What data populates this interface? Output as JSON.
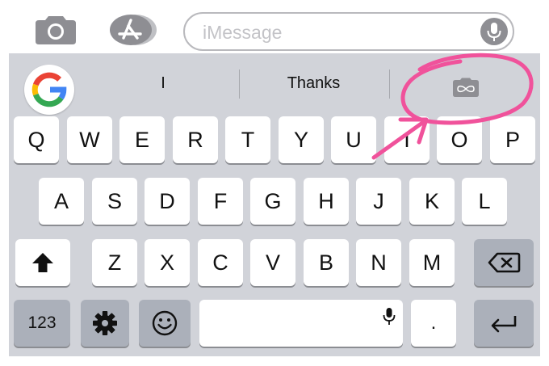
{
  "message_bar": {
    "placeholder": "iMessage",
    "icons": [
      "camera-icon",
      "app-store-icon",
      "microphone-icon"
    ]
  },
  "suggestions": {
    "items": [
      "I",
      "Thanks"
    ],
    "icons": [
      "google-logo-icon",
      "gif-search-icon"
    ]
  },
  "keyboard": {
    "row1": [
      "Q",
      "W",
      "E",
      "R",
      "T",
      "Y",
      "U",
      "I",
      "O",
      "P"
    ],
    "row2": [
      "A",
      "S",
      "D",
      "F",
      "G",
      "H",
      "J",
      "K",
      "L"
    ],
    "row3": [
      "Z",
      "X",
      "C",
      "V",
      "B",
      "N",
      "M"
    ],
    "numbers_label": "123",
    "period_label": ".",
    "icons": [
      "shift-icon",
      "backspace-icon",
      "settings-icon",
      "emoji-icon",
      "space-mic-icon",
      "return-icon"
    ]
  },
  "annotation": {
    "color": "#f0529b"
  }
}
